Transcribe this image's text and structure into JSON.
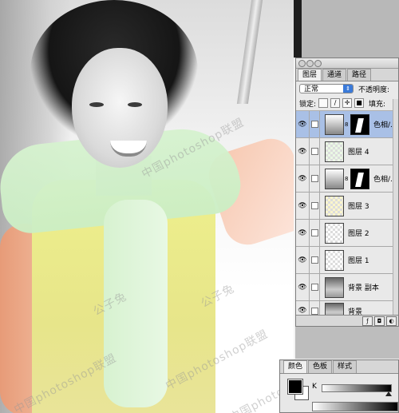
{
  "watermarks": [
    "中国photoshop联盟",
    "公子兔",
    "中国photoshop联盟",
    "公子兔",
    "中国photoshop联盟",
    "中国photoshop联盟"
  ],
  "layers_palette": {
    "tabs": [
      "图层",
      "通道",
      "路径"
    ],
    "active_tab": "图层",
    "blend_mode": "正常",
    "opacity_label": "不透明度:",
    "lock_label": "锁定:",
    "fill_label": "填充:",
    "layers": [
      {
        "name": "色相/...",
        "kind": "adjustment",
        "visible": true,
        "selected": true
      },
      {
        "name": "图层 4",
        "kind": "green",
        "visible": true,
        "selected": false
      },
      {
        "name": "色相/...",
        "kind": "adjustment",
        "visible": true,
        "selected": false
      },
      {
        "name": "图层 3",
        "kind": "yellow",
        "visible": true,
        "selected": false
      },
      {
        "name": "图层 2",
        "kind": "plain",
        "visible": true,
        "selected": false
      },
      {
        "name": "图层 1",
        "kind": "plain",
        "visible": true,
        "selected": false
      },
      {
        "name": "背景 副本",
        "kind": "image",
        "visible": true,
        "selected": false
      },
      {
        "name": "背景",
        "kind": "image",
        "visible": true,
        "selected": false
      }
    ]
  },
  "color_palette": {
    "tabs": [
      "颜色",
      "色板",
      "样式"
    ],
    "active_tab": "颜色",
    "channel_label": "K",
    "colors": {
      "foreground": "#000000",
      "background": "#ffffff",
      "selected_layer": "#a9c0e6"
    }
  }
}
